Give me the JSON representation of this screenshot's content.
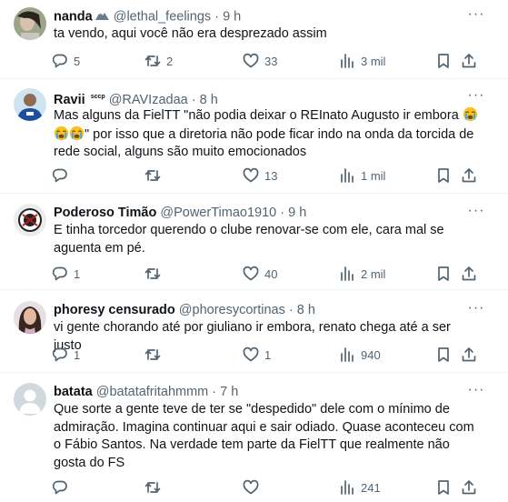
{
  "tweets": [
    {
      "name": "nanda",
      "handle": "@lethal_feelings",
      "dot": "·",
      "time": "9 h",
      "text": "ta vendo, aqui você não era desprezado assim",
      "replies": "5",
      "retweets": "2",
      "likes": "33",
      "views": "3 mil"
    },
    {
      "name": "Ravii",
      "badge": "sccp",
      "handle": "@RAVIzadaa",
      "dot": "·",
      "time": "8 h",
      "text_before": "Mas alguns da FielTT \"não podia deixar o REInato Augusto ir embora ",
      "text_after": "\" por isso que a diretoria não pode ficar indo na onda da torcida de rede social, alguns são muito emocionados",
      "emoji_name": "crying-face",
      "replies": "",
      "retweets": "",
      "likes": "13",
      "views": "1 mil"
    },
    {
      "name": "Poderoso Timão",
      "handle": "@PowerTimao1910",
      "dot": "·",
      "time": "9 h",
      "text": "E tinha torcedor querendo o clube renovar-se com ele, cara mal se aguenta em pé.",
      "replies": "1",
      "retweets": "",
      "likes": "40",
      "views": "2 mil"
    },
    {
      "name": "phoresy censurado",
      "handle": "@phoresycortinas",
      "dot": "·",
      "time": "8 h",
      "text": "vi gente chorando até por giuliano ir embora, renato chega até a ser justo",
      "replies": "1",
      "retweets": "",
      "likes": "1",
      "views": "940"
    },
    {
      "name": "batata",
      "handle": "@batatafritahmmm",
      "dot": "·",
      "time": "7 h",
      "text": "Que sorte a gente teve de ter se \"despedido\" dele com o mínimo de admiração. Imagina continuar aqui e sair odiado. Quase aconteceu com o Fábio Santos. Na verdade tem parte da FielTT que realmente não gosta do FS",
      "replies": "",
      "retweets": "",
      "likes": "",
      "views": "241"
    }
  ],
  "more_label": "···",
  "colors": {
    "text_primary": "#0f1419",
    "text_secondary": "#536471",
    "divider": "#eff3f4",
    "background": "#ffffff"
  },
  "icons": [
    "reply-icon",
    "retweet-icon",
    "like-icon",
    "views-icon",
    "bookmark-icon",
    "share-icon",
    "more-icon"
  ]
}
